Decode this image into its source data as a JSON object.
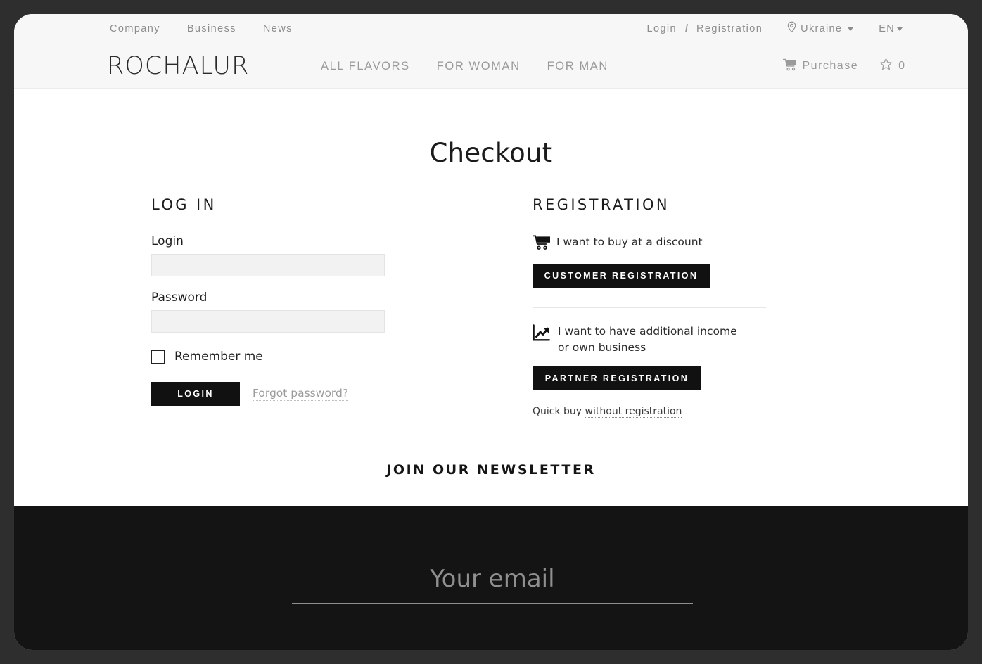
{
  "topbar": {
    "links": [
      {
        "label": "Company",
        "name": "topbar-link-company"
      },
      {
        "label": "Business",
        "name": "topbar-link-business"
      },
      {
        "label": "News",
        "name": "topbar-link-news"
      }
    ],
    "login_label": "Login",
    "separator": "/",
    "registration_label": "Registration",
    "region": {
      "icon": "map-pin-icon",
      "value": "Ukraine"
    },
    "language": {
      "value": "EN"
    }
  },
  "navbar": {
    "logo": "ROCHALUR",
    "links": [
      {
        "label": "ALL FLAVORS"
      },
      {
        "label": "FOR WOMAN"
      },
      {
        "label": "FOR MAN"
      }
    ],
    "cart": {
      "icon": "shopping-cart-icon",
      "label": "Purchase"
    },
    "favorites": {
      "icon": "star-icon",
      "count": "0"
    }
  },
  "page": {
    "title": "Checkout"
  },
  "login": {
    "heading": "LOG IN",
    "login_label": "Login",
    "login_value": "",
    "login_placeholder": "",
    "password_label": "Password",
    "password_value": "",
    "password_placeholder": "",
    "remember_label": "Remember me",
    "remember_checked": false,
    "submit_label": "LOGIN",
    "forgot_label": "Forgot password?"
  },
  "registration": {
    "heading": "REGISTRATION",
    "customer": {
      "icon": "shopping-cart-icon",
      "text": "I want to buy at a discount",
      "button_label": "CUSTOMER REGISTRATION"
    },
    "partner": {
      "icon": "chart-trend-up-icon",
      "text": "I want to have additional income or own business",
      "button_label": "PARTNER REGISTRATION"
    },
    "quick_buy_prefix": "Quick buy ",
    "quick_buy_link": "without registration"
  },
  "newsletter": {
    "heading": "JOIN OUR NEWSLETTER",
    "email_placeholder": "Your email",
    "email_value": ""
  },
  "colors": {
    "button_dark": "#111111",
    "footer_bg": "#141414",
    "bar_bg": "#f7f7f7",
    "input_bg": "#f2f2f2",
    "muted_text": "#8d8d8d",
    "frame": "#2e2e2e"
  }
}
